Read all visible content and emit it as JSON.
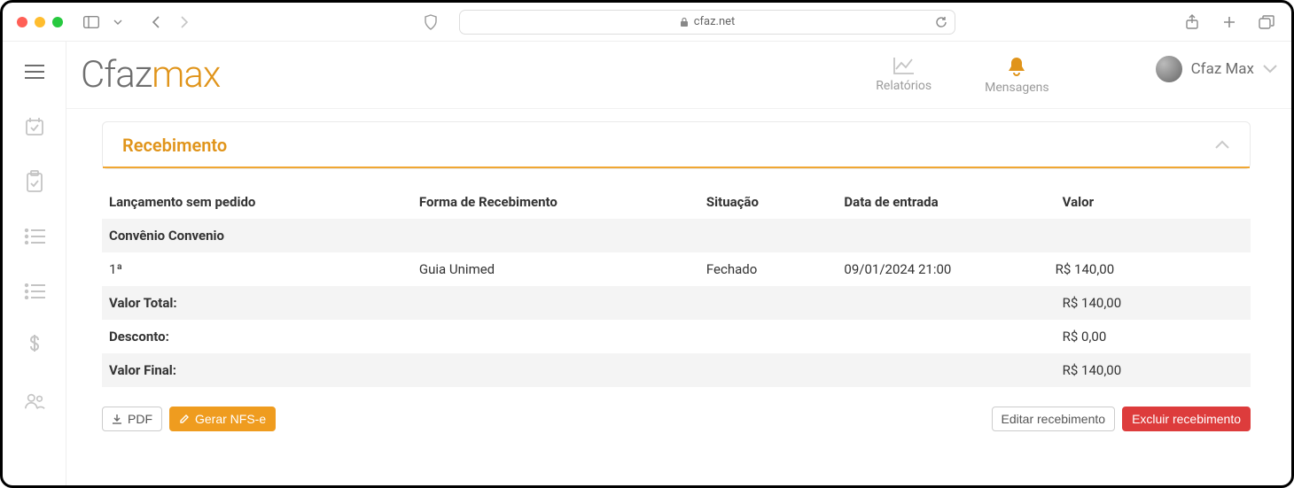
{
  "browser": {
    "url": "cfaz.net"
  },
  "logo": {
    "part1": "Cfaz",
    "part2": "max"
  },
  "nav": {
    "reports": "Relatórios",
    "messages": "Mensagens"
  },
  "user": {
    "name": "Cfaz Max"
  },
  "panel": {
    "title": "Recebimento"
  },
  "table": {
    "headers": {
      "c1": "Lançamento sem pedido",
      "c2": "Forma de Recebimento",
      "c3": "Situação",
      "c4": "Data de entrada",
      "c5": "Valor"
    },
    "groupHeader": "Convênio Convenio",
    "row": {
      "c1": "1ª",
      "c2": "Guia Unimed",
      "c3": "Fechado",
      "c4": "09/01/2024 21:00",
      "c5": "R$ 140,00"
    },
    "total": {
      "label": "Valor Total:",
      "value": "R$ 140,00"
    },
    "discount": {
      "label": "Desconto:",
      "value": "R$ 0,00"
    },
    "final": {
      "label": "Valor Final:",
      "value": "R$ 140,00"
    }
  },
  "buttons": {
    "pdf": "PDF",
    "nfse": "Gerar NFS-e",
    "edit": "Editar recebimento",
    "delete": "Excluir recebimento"
  }
}
